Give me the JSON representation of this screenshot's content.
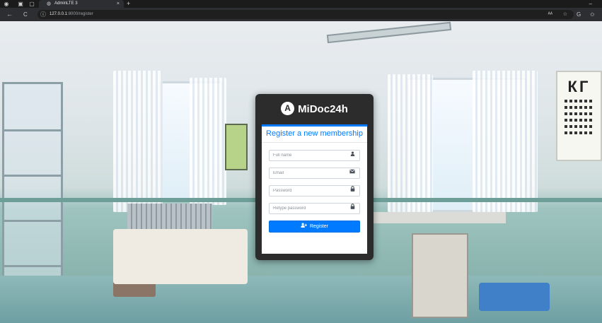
{
  "browser": {
    "tab_title": "AdminLTE 3",
    "tab_close": "×",
    "new_tab": "+",
    "url_host": "127.0.0.1",
    "url_path": ":8000/register",
    "window_minimize": "–",
    "back": "←",
    "reload": "C",
    "info": "ⓘ",
    "read_aloud": "ᴬᴬ",
    "star": "☆",
    "extensions": "G",
    "favorites": "✩"
  },
  "brand": {
    "logo_letter": "A",
    "name": "MiDoc24h"
  },
  "form": {
    "title": "Register a new membership",
    "full_name": {
      "placeholder": "Full name",
      "icon": "user-icon"
    },
    "email": {
      "placeholder": "Email",
      "icon": "envelope-icon"
    },
    "password": {
      "placeholder": "Password",
      "icon": "lock-icon"
    },
    "retype": {
      "placeholder": "Retype password",
      "icon": "lock-icon"
    },
    "register_label": "Register",
    "register_icon": "user-plus-icon"
  },
  "colors": {
    "accent": "#007bff",
    "card_background": "#2c2c2c"
  }
}
